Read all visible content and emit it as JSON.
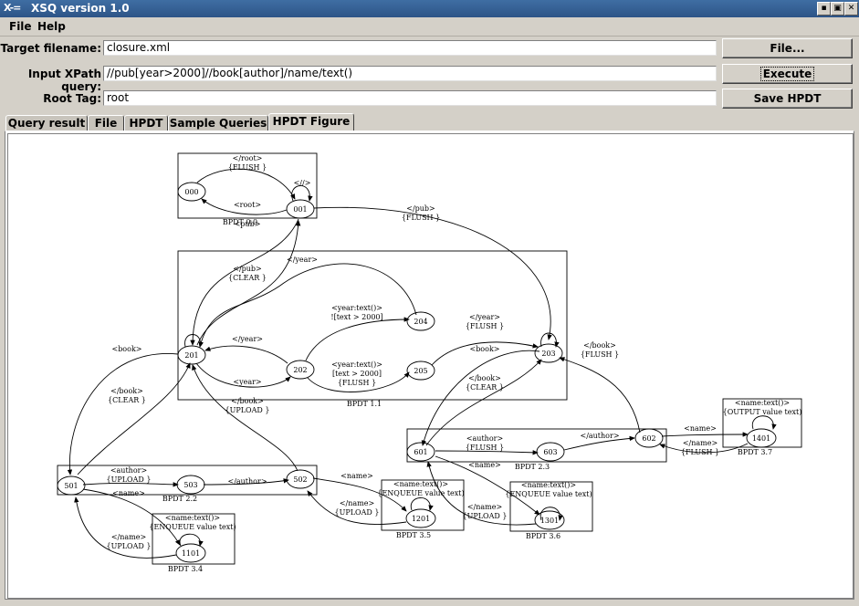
{
  "window": {
    "logo": "X-=",
    "title": "XSQ version 1.0",
    "controls": [
      "▪",
      "▣",
      "✕"
    ]
  },
  "menu": [
    "File",
    "Help"
  ],
  "form": {
    "target_label": "Target filename:",
    "target_value": "closure.xml",
    "query_label": "Input XPath query:",
    "query_value": "//pub[year>2000]//book[author]/name/text()",
    "root_label": "Root Tag:",
    "root_value": "root"
  },
  "buttons": {
    "file": "File...",
    "execute": "Execute",
    "save": "Save HPDT"
  },
  "tabs": [
    "Query result",
    "File",
    "HPDT",
    "Sample Queries",
    "HPDT Figure"
  ],
  "active_tab": "HPDT Figure",
  "figure": {
    "boxes": [
      "BPDT 0.0",
      "BPDT 1.1",
      "BPDT 2.2",
      "BPDT 2.3",
      "BPDT 3.4",
      "BPDT 3.5",
      "BPDT 3.6",
      "BPDT 3.7"
    ],
    "states": [
      "000",
      "001",
      "201",
      "202",
      "203",
      "204",
      "205",
      "501",
      "502",
      "503",
      "601",
      "602",
      "603",
      "1101",
      "1201",
      "1301",
      "1401"
    ],
    "edge_labels": {
      "root_close": "</root>",
      "flush": "{FLUSH }",
      "root_open": "<root>",
      "self_close": "<//>",
      "pub_open": "<pub>",
      "pub_close": "</pub>",
      "flush_right": "{FLUSH  }",
      "pub_close_2": "</pub>",
      "clear": "{CLEAR }",
      "year_close": "</year>",
      "yeartext": "<year:text()>",
      "not_text_2000": "![text > 2000]",
      "year_close_2": "</year>",
      "flush_2": "{FLUSH  }",
      "year_close_3": "</year>",
      "year_open": "<year>",
      "yeartext_2": "<year:text()>",
      "text_2000": "[text > 2000]",
      "flush_3": "{FLUSH  }",
      "book_open": "<book>",
      "book_open_2": "<book>",
      "book_close": "</book>",
      "clear_2": "{CLEAR  }",
      "book_close_2": "</book>",
      "clear_3": "{CLEAR  }",
      "book_close_3": "</book>",
      "flush_4": "{FLUSH  }",
      "book_close_4": "</book>",
      "upload": "{UPLOAD  }",
      "author_open": "<author>",
      "upload_2": "{UPLOAD  }",
      "author_close": "</author>",
      "name_open": "<name>",
      "author_open_2": "<author>",
      "flush_5": "{FLUSH  }",
      "author_close_2": "</author>",
      "name_open_2": "<name>",
      "name_close": "</name>",
      "flush_6": "{FLUSH  }",
      "nametext": "<name:text()>",
      "output_value": "{OUTPUT value text)",
      "name_open_3": "<name>",
      "name_close_2": "</name>",
      "upload_3": "{UPLOAD  }",
      "nametext_2": "<name:text()>",
      "enqueue": "{ENQUEUE value text)",
      "name_open_4": "<name>",
      "name_close_3": "</name>",
      "upload_4": "{UPLOAD }",
      "nametext_3": "<name:text()>",
      "enqueue_2": "{ENQUEUE value text)",
      "name_close_4": "</name>",
      "upload_5": "{UPLOAD  }",
      "nametext_4": "<name:text()>",
      "enqueue_3": "{ENQUEUE value text)"
    }
  }
}
